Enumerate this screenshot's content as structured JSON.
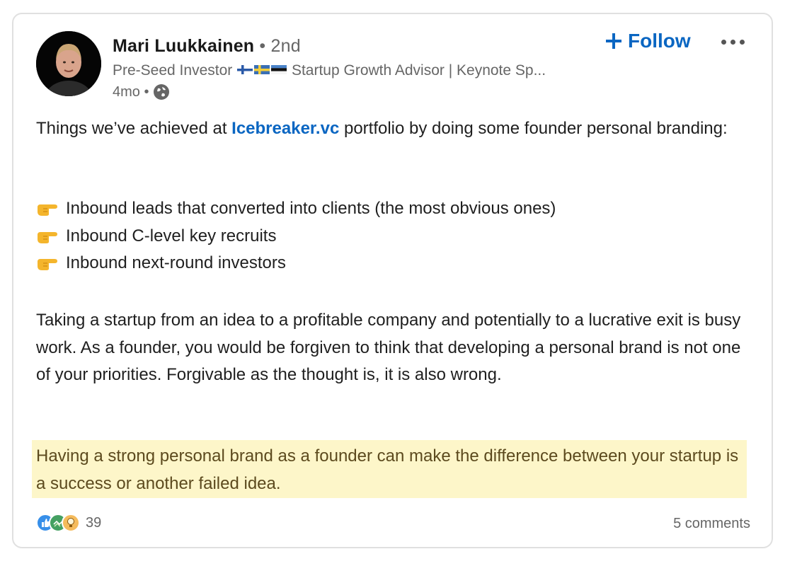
{
  "post": {
    "author": {
      "name": "Mari Luukkainen",
      "degree": "• 2nd",
      "headline_start": "Pre-Seed Investor",
      "headline_end": "Startup Growth Advisor | Keynote Sp...",
      "time": "4mo •",
      "visibility_icon": "globe-icon"
    },
    "actions": {
      "follow_label": "Follow",
      "follow_icon": "plus-icon",
      "more_icon": "more-options-icon"
    },
    "content": {
      "intro_before_link": "Things we’ve achieved at ",
      "intro_link": "Icebreaker.vc",
      "intro_after_link": " portfolio by doing some founder personal branding:",
      "bullets": [
        "Inbound leads that converted into clients (the most obvious ones)",
        "Inbound C-level key recruits",
        "Inbound next-round investors"
      ],
      "bullet_icon": "pointing-hand-icon",
      "paragraph": "Taking a startup from an idea to a profitable company and potentially to a lucrative exit is busy work. As a founder, you would be forgiven to think that developing a personal brand is not one of your priorities. Forgivable as the thought is, it is also wrong.",
      "highlight": "Having a strong personal brand as a founder can make the difference between your startup is a success or another failed idea."
    },
    "social": {
      "reaction_icons": [
        "like-icon",
        "support-icon",
        "insightful-icon"
      ],
      "reaction_count": "39",
      "comments": "5 comments"
    },
    "colors": {
      "accent": "#0a66c2",
      "highlight_bg": "#fdf6c9",
      "muted_text": "#666666"
    }
  }
}
